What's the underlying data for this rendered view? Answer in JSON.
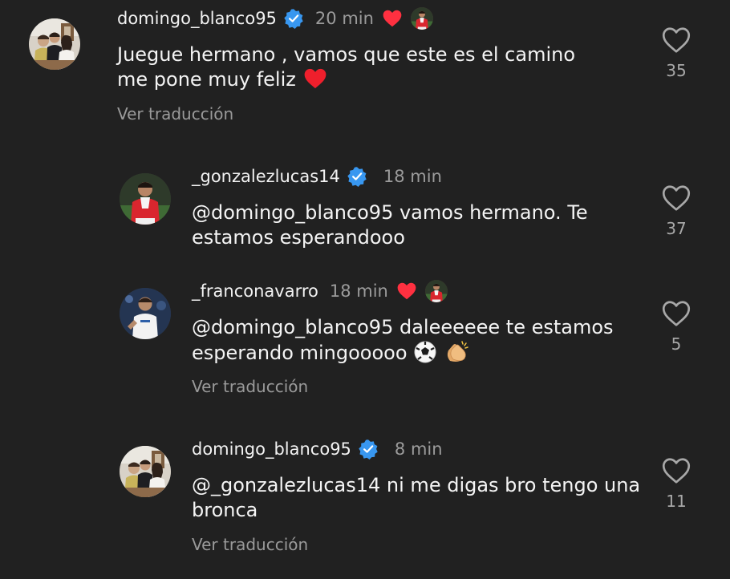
{
  "comments": [
    {
      "username": "domingo_blanco95",
      "time": "20 min",
      "text": "Juegue hermano , vamos que este es el camino me pone muy feliz",
      "translate": "Ver traducción",
      "likes": "35"
    },
    {
      "username": "_gonzalezlucas14",
      "time": "18 min",
      "mention": "@domingo_blanco95",
      "text": " vamos hermano. Te estamos esperandooo",
      "likes": "37"
    },
    {
      "username": "_franconavarro",
      "time": "18 min",
      "mention": "@domingo_blanco95",
      "text": " daleeeeee te estamos esperando mingooooo",
      "translate": "Ver traducción",
      "likes": "5"
    },
    {
      "username": "domingo_blanco95",
      "time": "8 min",
      "mention": "@_gonzalezlucas14",
      "text": " ni me digas bro tengo una bronca",
      "translate": "Ver traducción",
      "likes": "11"
    }
  ],
  "colors": {
    "background": "#212121",
    "verified": "#3897f0",
    "liked_heart": "#ff3040",
    "secondary_text": "#9b9b9b"
  },
  "icons": {
    "like": "heart-outline-icon",
    "verified": "verified-badge-icon",
    "author_liked": "red-heart-icon"
  }
}
